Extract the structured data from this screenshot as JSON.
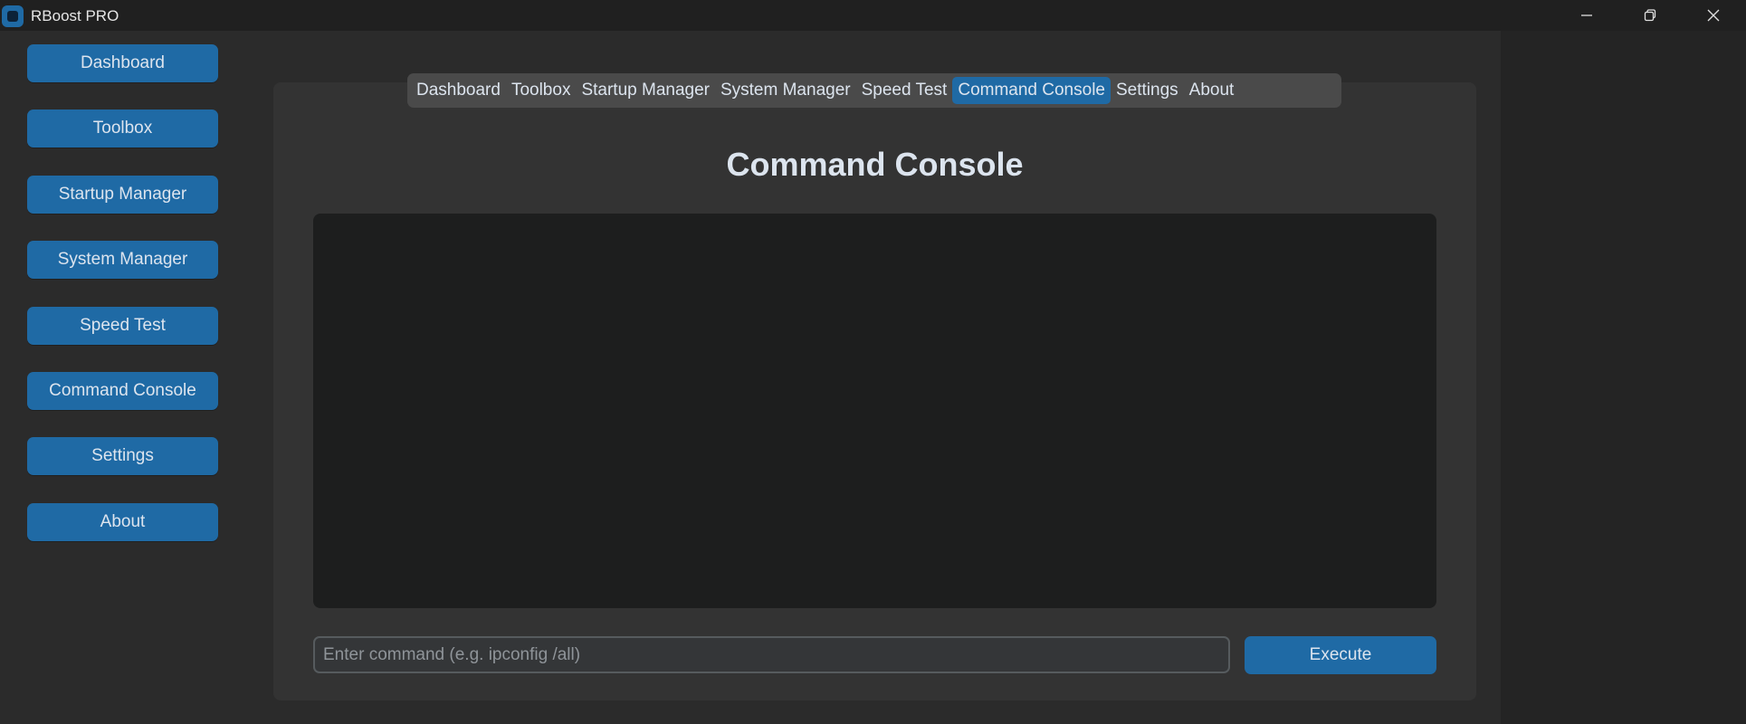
{
  "window": {
    "title": "RBoost PRO",
    "controls": [
      "minimize",
      "restore",
      "close"
    ]
  },
  "sidebar": {
    "items": [
      {
        "label": "Dashboard"
      },
      {
        "label": "Toolbox"
      },
      {
        "label": "Startup Manager"
      },
      {
        "label": "System Manager"
      },
      {
        "label": "Speed Test"
      },
      {
        "label": "Command Console"
      },
      {
        "label": "Settings"
      },
      {
        "label": "About"
      }
    ]
  },
  "tabs": {
    "items": [
      {
        "label": "Dashboard",
        "active": false
      },
      {
        "label": "Toolbox",
        "active": false
      },
      {
        "label": "Startup Manager",
        "active": false
      },
      {
        "label": "System Manager",
        "active": false
      },
      {
        "label": "Speed Test",
        "active": false
      },
      {
        "label": "Command Console",
        "active": true
      },
      {
        "label": "Settings",
        "active": false
      },
      {
        "label": "About",
        "active": false
      }
    ]
  },
  "console": {
    "title": "Command Console",
    "output": "",
    "input_value": "",
    "input_placeholder": "Enter command (e.g. ipconfig /all)",
    "execute_label": "Execute"
  },
  "colors": {
    "accent": "#1f6aa5",
    "background": "#242424",
    "panel": "#333333",
    "output_bg": "#1d1e1e"
  }
}
